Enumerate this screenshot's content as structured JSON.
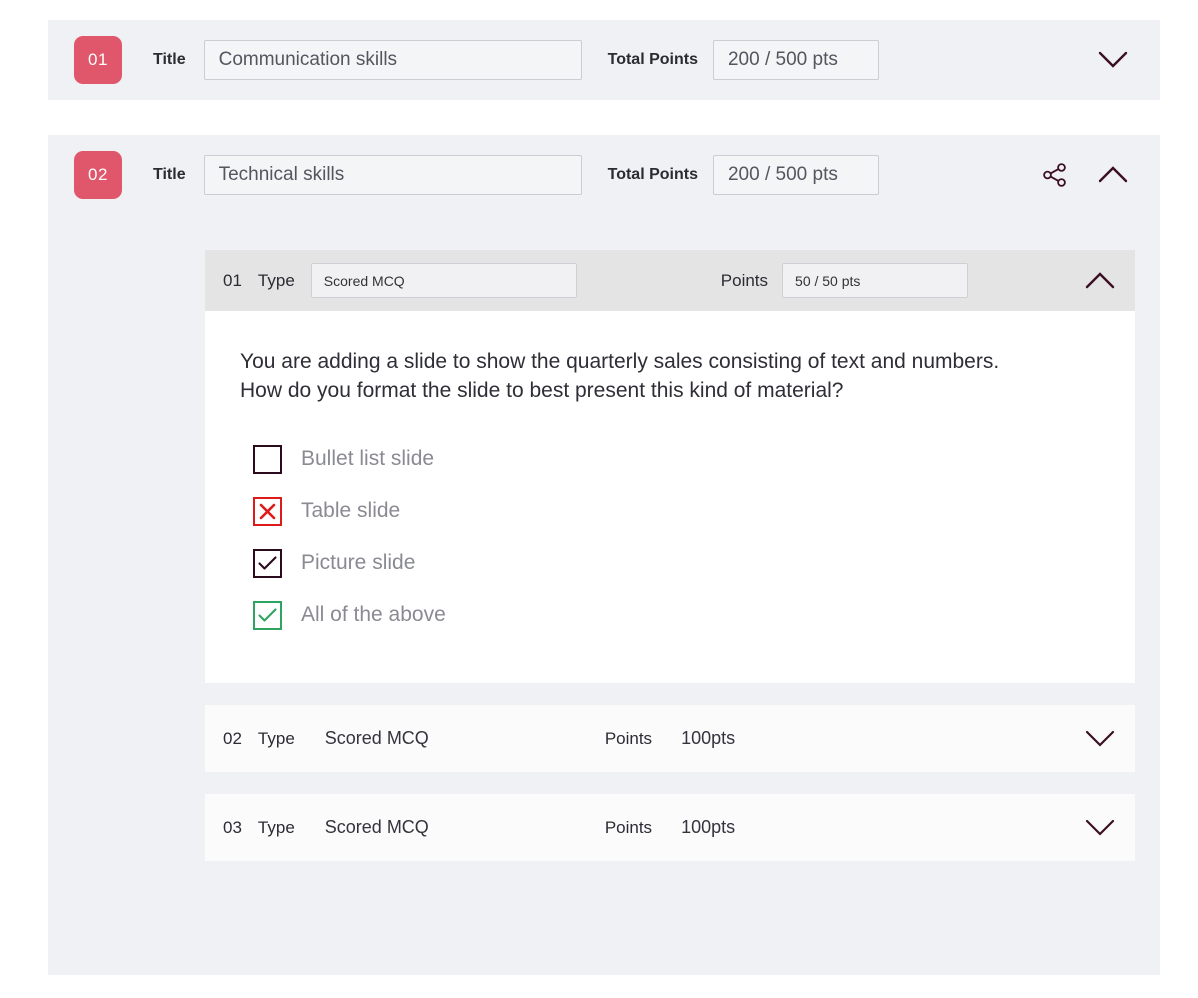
{
  "sections": [
    {
      "number": "01",
      "title_label": "Title",
      "title_value": "Communication skills",
      "points_label": "Total Points",
      "points_value": "200 / 500 pts",
      "expanded": false,
      "chevron_icon": "chevron-down-icon"
    },
    {
      "number": "02",
      "title_label": "Title",
      "title_value": "Technical skills",
      "points_label": "Total Points",
      "points_value": "200 / 500 pts",
      "expanded": true,
      "share_icon": "share-icon",
      "chevron_icon": "chevron-up-icon"
    }
  ],
  "questions": [
    {
      "number": "01",
      "type_label": "Type",
      "type_value": "Scored MCQ",
      "points_label": "Points",
      "points_value": "50 / 50 pts",
      "expanded": true,
      "chevron_icon": "chevron-up-icon",
      "prompt": "You are adding a slide to show the quarterly sales consisting of text and numbers. How do you format the slide to best present this kind of material?",
      "options": [
        {
          "label": "Bullet list slide",
          "state": "empty"
        },
        {
          "label": "Table slide",
          "state": "wrong"
        },
        {
          "label": "Picture slide",
          "state": "checked"
        },
        {
          "label": "All of the above",
          "state": "correct"
        }
      ]
    },
    {
      "number": "02",
      "type_label": "Type",
      "type_value": "Scored MCQ",
      "points_label": "Points",
      "points_value": "100pts",
      "expanded": false,
      "chevron_icon": "chevron-down-icon"
    },
    {
      "number": "03",
      "type_label": "Type",
      "type_value": "Scored MCQ",
      "points_label": "Points",
      "points_value": "100pts",
      "expanded": false,
      "chevron_icon": "chevron-down-icon"
    }
  ],
  "colors": {
    "badge": "#e0566a",
    "chevron": "#3b0f23",
    "wrong": "#de1b1b",
    "correct": "#2fa360",
    "checked": "#2b0a1e",
    "panel_bg": "#f0f1f4",
    "question_header_bg": "#e4e4e4"
  }
}
